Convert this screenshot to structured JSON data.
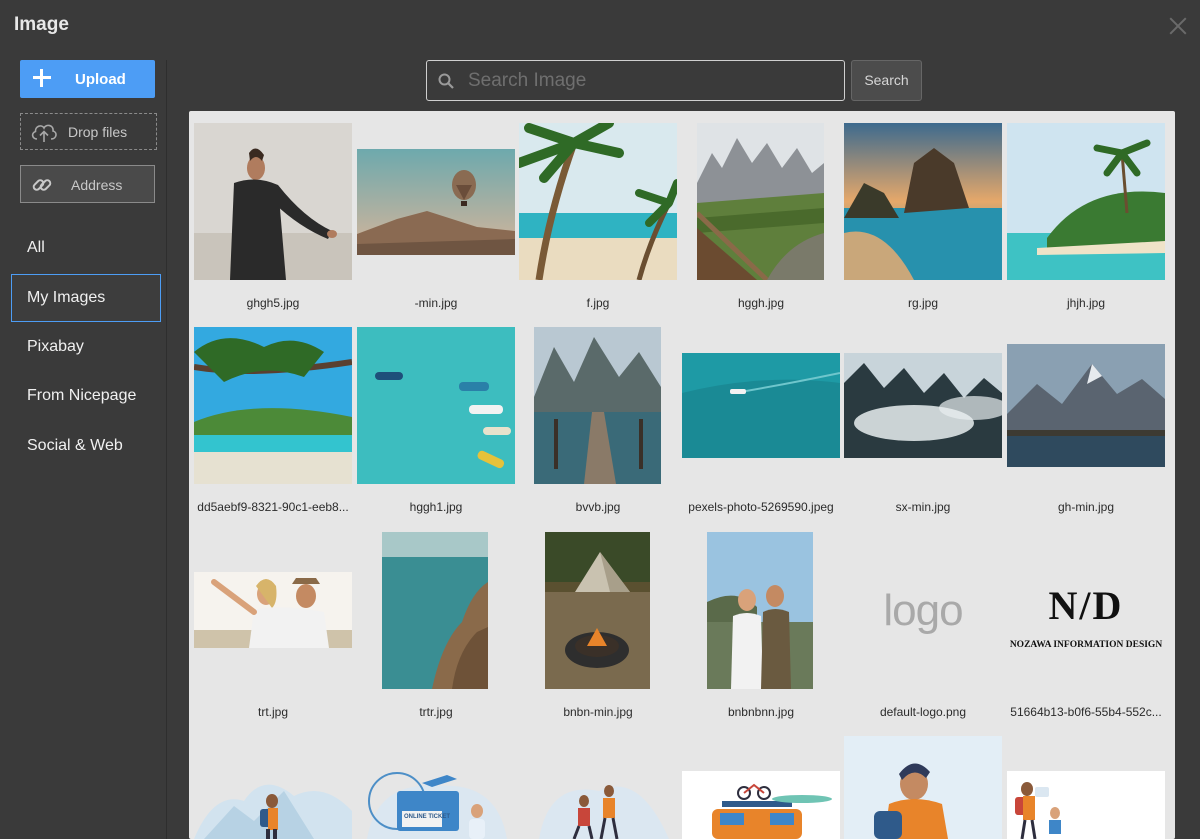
{
  "dialog": {
    "title": "Image"
  },
  "sidebar": {
    "upload_label": "Upload",
    "drop_label": "Drop files",
    "address_label": "Address",
    "nav": [
      "All",
      "My Images",
      "Pixabay",
      "From Nicepage",
      "Social & Web"
    ],
    "active_nav": "My Images"
  },
  "search": {
    "placeholder": "Search Image",
    "button_label": "Search"
  },
  "gallery": {
    "items": [
      {
        "name": "ghgh5.jpg",
        "icon": "image-man-outdoors"
      },
      {
        "name": "-min.jpg",
        "icon": "image-hot-air-balloon"
      },
      {
        "name": "f.jpg",
        "icon": "image-palm-beach"
      },
      {
        "name": "hggh.jpg",
        "icon": "image-mountain-fence"
      },
      {
        "name": "rg.jpg",
        "icon": "image-rock-island"
      },
      {
        "name": "jhjh.jpg",
        "icon": "image-tropical-island"
      },
      {
        "name": "dd5aebf9-8321-90c1-eeb8...",
        "icon": "image-beach-branch"
      },
      {
        "name": "hggh1.jpg",
        "icon": "image-boats-aerial"
      },
      {
        "name": "bvvb.jpg",
        "icon": "image-lake-pier"
      },
      {
        "name": "pexels-photo-5269590.jpeg",
        "icon": "image-boat-sea"
      },
      {
        "name": "sx-min.jpg",
        "icon": "image-misty-forest"
      },
      {
        "name": "gh-min.jpg",
        "icon": "image-mountain-lake"
      },
      {
        "name": "trt.jpg",
        "icon": "image-couple-happy"
      },
      {
        "name": "trtr.jpg",
        "icon": "image-cliff-sea"
      },
      {
        "name": "bnbn-min.jpg",
        "icon": "image-tent-campfire"
      },
      {
        "name": "bnbnbnn.jpg",
        "icon": "image-two-hikers"
      },
      {
        "name": "default-logo.png",
        "icon": "image-logo-placeholder",
        "logo_text": "logo"
      },
      {
        "name": "51664b13-b0f6-55b4-552c...",
        "icon": "image-nid-logo",
        "brand_mark": "N/D",
        "brand_name": "NOZAWA INFORMATION DESIGN"
      },
      {
        "name": "",
        "icon": "illustration-hiker"
      },
      {
        "name": "",
        "icon": "illustration-online-ticket",
        "ticket_text": "ONLINE TICKET"
      },
      {
        "name": "",
        "icon": "illustration-hikers"
      },
      {
        "name": "",
        "icon": "illustration-van-bikes"
      },
      {
        "name": "",
        "icon": "illustration-backpacker"
      },
      {
        "name": "",
        "icon": "illustration-hiker-child"
      }
    ]
  }
}
